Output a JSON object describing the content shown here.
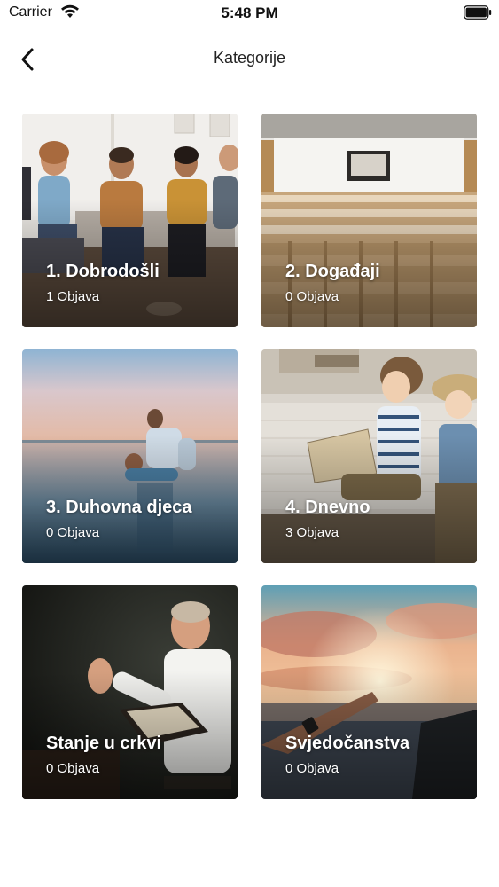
{
  "status": {
    "carrier": "Carrier",
    "time": "5:48 PM"
  },
  "nav": {
    "title": "Kategorije",
    "back_icon": "chevron-left-icon"
  },
  "categories": [
    {
      "title": "1. Dobrodošli",
      "count": "1 Objava"
    },
    {
      "title": "2. Događaji",
      "count": "0 Objava"
    },
    {
      "title": "3. Duhovna djeca",
      "count": "0 Objava"
    },
    {
      "title": "4. Dnevno",
      "count": "3 Objava"
    },
    {
      "title": "Stanje u crkvi",
      "count": "0 Objava"
    },
    {
      "title": "Svjedočanstva",
      "count": "0 Objava"
    }
  ]
}
